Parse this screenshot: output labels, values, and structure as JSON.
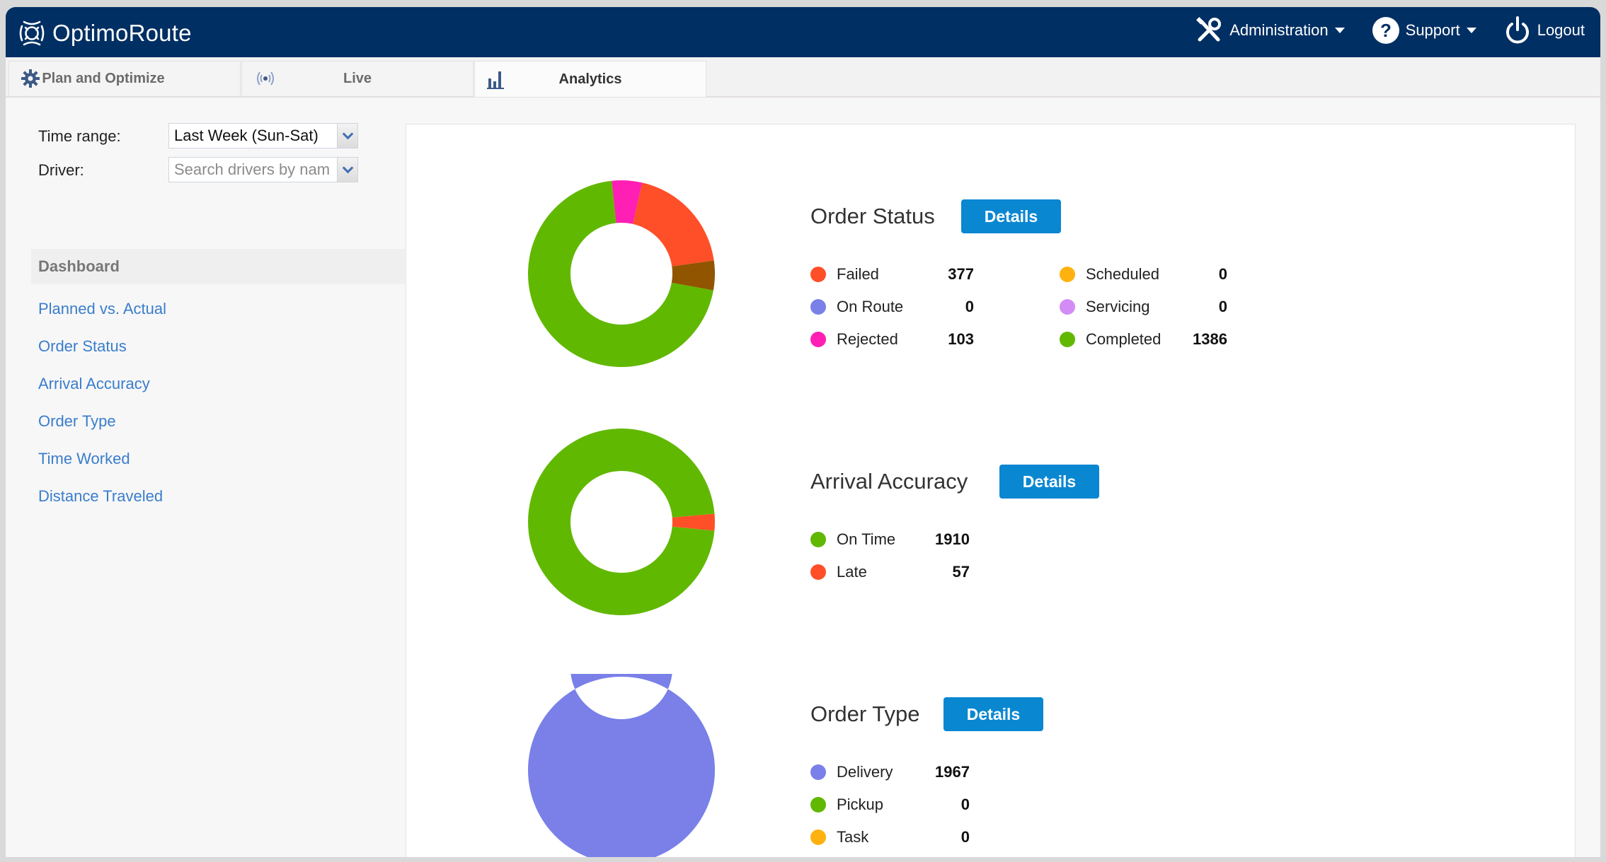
{
  "app": {
    "title": "OptimoRoute"
  },
  "header": {
    "admin_label": "Administration",
    "support_label": "Support",
    "logout_label": "Logout"
  },
  "tabs": [
    {
      "label": "Plan and Optimize",
      "icon": "gear-icon"
    },
    {
      "label": "Live",
      "icon": "broadcast-icon"
    },
    {
      "label": "Analytics",
      "icon": "bar-chart-icon",
      "active": true
    }
  ],
  "filters": {
    "time_range_label": "Time range:",
    "time_range_value": "Last Week (Sun-Sat)",
    "driver_label": "Driver:",
    "driver_placeholder": "Search drivers by nam"
  },
  "sidebar": {
    "heading": "Dashboard",
    "links": [
      "Planned vs. Actual",
      "Order Status",
      "Arrival Accuracy",
      "Order Type",
      "Time Worked",
      "Distance Traveled"
    ]
  },
  "details_label": "Details",
  "chart_data": [
    {
      "type": "pie",
      "donut": true,
      "title": "Order Status",
      "legend_position": "right",
      "slices": [
        {
          "label": "Rejected",
          "value": 103,
          "color": "#ff1fb4"
        },
        {
          "label": "Failed",
          "value": 377,
          "color": "#ff4f28"
        },
        {
          "label": "",
          "value": 101,
          "color": "#915500"
        },
        {
          "label": "Completed",
          "value": 1386,
          "color": "#61b800"
        }
      ],
      "legend": [
        {
          "label": "Failed",
          "value": "377",
          "color": "#ff4f28"
        },
        {
          "label": "On Route",
          "value": "0",
          "color": "#7a80e8"
        },
        {
          "label": "Rejected",
          "value": "103",
          "color": "#ff1fb4"
        },
        {
          "label": "Scheduled",
          "value": "0",
          "color": "#ffb20f"
        },
        {
          "label": "Servicing",
          "value": "0",
          "color": "#d38cf5"
        },
        {
          "label": "Completed",
          "value": "1386",
          "color": "#61b800"
        }
      ],
      "start_angle_deg": -6
    },
    {
      "type": "pie",
      "donut": true,
      "title": "Arrival Accuracy",
      "legend_position": "right",
      "slices": [
        {
          "label": "Late",
          "value": 57,
          "color": "#ff4f28"
        },
        {
          "label": "On Time",
          "value": 1910,
          "color": "#61b800"
        }
      ],
      "legend": [
        {
          "label": "On Time",
          "value": "1910",
          "color": "#61b800"
        },
        {
          "label": "Late",
          "value": "57",
          "color": "#ff4f28"
        }
      ],
      "start_angle_deg": 85
    },
    {
      "type": "pie",
      "donut": true,
      "title": "Order Type",
      "legend_position": "right",
      "slices": [
        {
          "label": "Delivery",
          "value": 1967,
          "color": "#7a80e8"
        },
        {
          "label": "Pickup",
          "value": 0,
          "color": "#61b800"
        },
        {
          "label": "Task",
          "value": 0,
          "color": "#ffb20f"
        }
      ],
      "legend": [
        {
          "label": "Delivery",
          "value": "1967",
          "color": "#7a80e8"
        },
        {
          "label": "Pickup",
          "value": "0",
          "color": "#61b800"
        },
        {
          "label": "Task",
          "value": "0",
          "color": "#ffb20f"
        }
      ],
      "start_angle_deg": 0
    }
  ]
}
